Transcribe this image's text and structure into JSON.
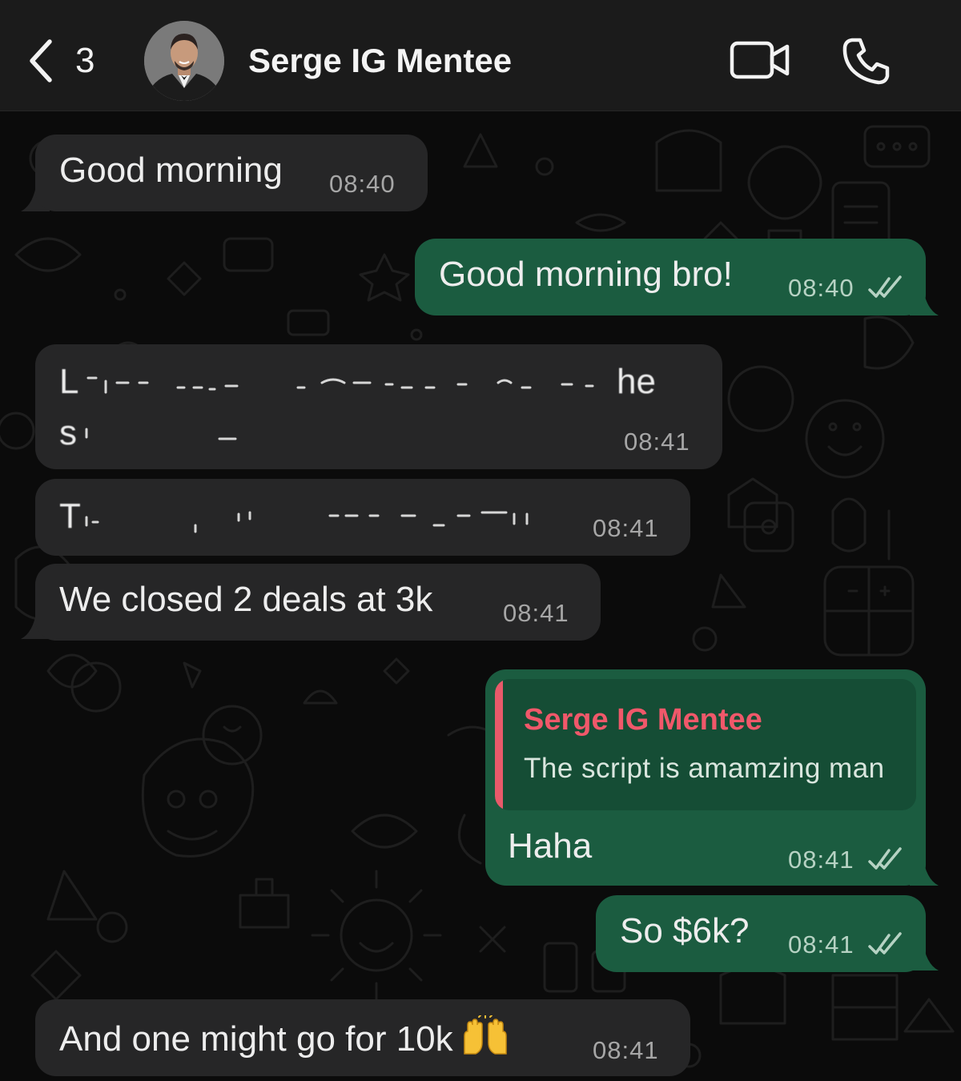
{
  "header": {
    "back_count": "3",
    "contact_name": "Serge IG Mentee",
    "back_icon": "chevron-left-icon",
    "video_icon": "video-camera-icon",
    "call_icon": "phone-icon"
  },
  "messages": [
    {
      "direction": "in",
      "text": "Good morning",
      "time": "08:40"
    },
    {
      "direction": "out",
      "text": "Good morning bro!",
      "time": "08:40",
      "status": "read"
    },
    {
      "direction": "in",
      "text_visible_line1_start": "L",
      "text_visible_line1_end": "he",
      "text_visible_line2": "s",
      "redacted": true,
      "time": "08:41"
    },
    {
      "direction": "in",
      "text_visible": "T",
      "redacted": true,
      "time": "08:41"
    },
    {
      "direction": "in",
      "text": "We closed 2 deals at 3k",
      "time": "08:41"
    },
    {
      "direction": "out",
      "quote_author": "Serge IG Mentee",
      "quote_text": "The script is amamzing man",
      "text": "Haha",
      "time": "08:41",
      "status": "read"
    },
    {
      "direction": "out",
      "text": "So $6k?",
      "time": "08:41",
      "status": "read"
    },
    {
      "direction": "in",
      "text": "And one might go for 10k",
      "emoji": "raising-hands-emoji",
      "time": "08:41"
    }
  ],
  "colors": {
    "header_bg": "#1b1b1b",
    "incoming_bubble": "#262627",
    "outgoing_bubble": "#1b5c40",
    "quote_accent": "#e85a6a",
    "read_ticks": "#b6d2c3"
  }
}
